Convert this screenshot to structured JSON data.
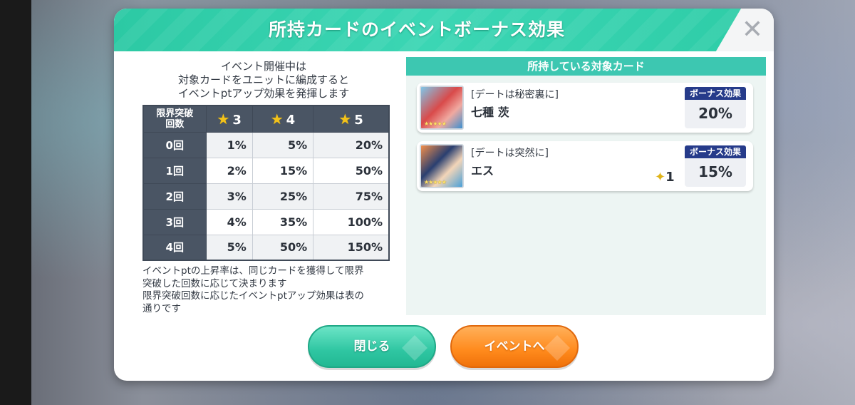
{
  "header": {
    "title": "所持カードのイベントボーナス効果",
    "close_symbol": "✕"
  },
  "left": {
    "intro_lines": [
      "イベント開催中は",
      "対象カードをユニットに編成すると",
      "イベントptアップ効果を発揮します"
    ],
    "table": {
      "rank_header_line1": "限界突破",
      "rank_header_line2": "回数",
      "rarity_headers": [
        "3",
        "4",
        "5"
      ],
      "rows": [
        {
          "rank": "0回",
          "values": [
            "1%",
            "5%",
            "20%"
          ]
        },
        {
          "rank": "1回",
          "values": [
            "2%",
            "15%",
            "50%"
          ]
        },
        {
          "rank": "2回",
          "values": [
            "3%",
            "25%",
            "75%"
          ]
        },
        {
          "rank": "3回",
          "values": [
            "4%",
            "35%",
            "100%"
          ]
        },
        {
          "rank": "4回",
          "values": [
            "5%",
            "50%",
            "150%"
          ]
        }
      ]
    },
    "note_lines": [
      "イベントptの上昇率は、同じカードを獲得して限界",
      "突破した回数に応じて決まります",
      "限界突破回数に応じたイベントptアップ効果は表の",
      "通りです"
    ]
  },
  "right": {
    "header": "所持している対象カード",
    "cards": [
      {
        "title": "[デートは秘密裏に]",
        "name": "七種 茨",
        "bonus_label": "ボーナス効果",
        "bonus_value": "20%",
        "limit_break": ""
      },
      {
        "title": "[デートは突然に]",
        "name": "エス",
        "bonus_label": "ボーナス効果",
        "bonus_value": "15%",
        "limit_break": "1"
      }
    ]
  },
  "buttons": {
    "close_label": "閉じる",
    "event_label": "イベントへ"
  },
  "colors": {
    "accent_green": "#2cc9a4",
    "accent_orange": "#ff8a1c",
    "table_header": "#4a5564",
    "bonus_label_bg": "#263b8a"
  }
}
